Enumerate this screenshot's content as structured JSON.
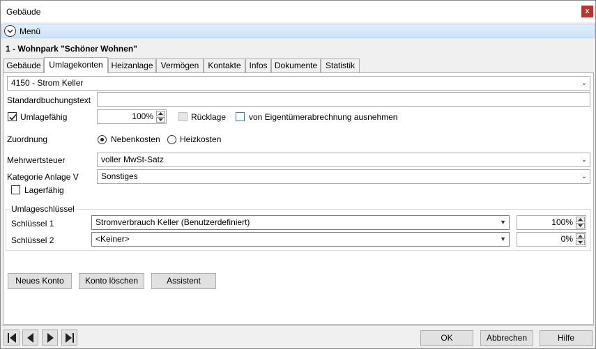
{
  "window": {
    "title": "Gebäude",
    "close_label": "x"
  },
  "menu": {
    "label": "Menü"
  },
  "heading": "1 - Wohnpark \"Schöner Wohnen\"",
  "tabs": [
    {
      "label": "Gebäude",
      "active": false
    },
    {
      "label": "Umlagekonten",
      "active": true
    },
    {
      "label": "Heizanlage",
      "active": false
    },
    {
      "label": "Vermögen",
      "active": false
    },
    {
      "label": "Kontakte",
      "active": false
    },
    {
      "label": "Infos",
      "active": false
    },
    {
      "label": "Dokumente",
      "active": false
    },
    {
      "label": "Statistik",
      "active": false
    }
  ],
  "account_select": {
    "value": "4150 - Strom Keller"
  },
  "standard_booking": {
    "label": "Standardbuchungstext",
    "value": ""
  },
  "umlagefaehig": {
    "label": "Umlagefähig",
    "checked": true,
    "percent": "100%"
  },
  "ruecklage": {
    "label": "Rücklage",
    "checked": false
  },
  "exclude_owner": {
    "label": "von Eigentümerabrechnung ausnehmen",
    "checked": false
  },
  "zuordnung": {
    "label": "Zuordnung",
    "options": [
      {
        "label": "Nebenkosten",
        "selected": true
      },
      {
        "label": "Heizkosten",
        "selected": false
      }
    ]
  },
  "mwst": {
    "label": "Mehrwertsteuer",
    "value": "voller MwSt-Satz"
  },
  "kategorie": {
    "label": "Kategorie Anlage V",
    "value": "Sonstiges"
  },
  "lagerfaehig": {
    "label": "Lagerfähig",
    "checked": false
  },
  "umlageschluessel": {
    "title": "Umlageschlüssel",
    "rows": [
      {
        "label": "Schlüssel 1",
        "value": "Stromverbrauch Keller (Benutzerdefiniert)",
        "percent": "100%"
      },
      {
        "label": "Schlüssel 2",
        "value": "<Keiner>",
        "percent": "0%"
      }
    ]
  },
  "actions": {
    "new_account": "Neues Konto",
    "delete_account": "Konto löschen",
    "assistant": "Assistent"
  },
  "footer": {
    "ok": "OK",
    "cancel": "Abbrechen",
    "help": "Hilfe"
  },
  "icons": {
    "menu_toggle": "chevron-down-circle-icon",
    "nav_first": "first-record-icon",
    "nav_prev": "previous-record-icon",
    "nav_next": "next-record-icon",
    "nav_last": "last-record-icon"
  },
  "colors": {
    "close": "#c6302b",
    "menubar": "#cfe2f7",
    "checkbox_accent": "#3a7bd5"
  }
}
